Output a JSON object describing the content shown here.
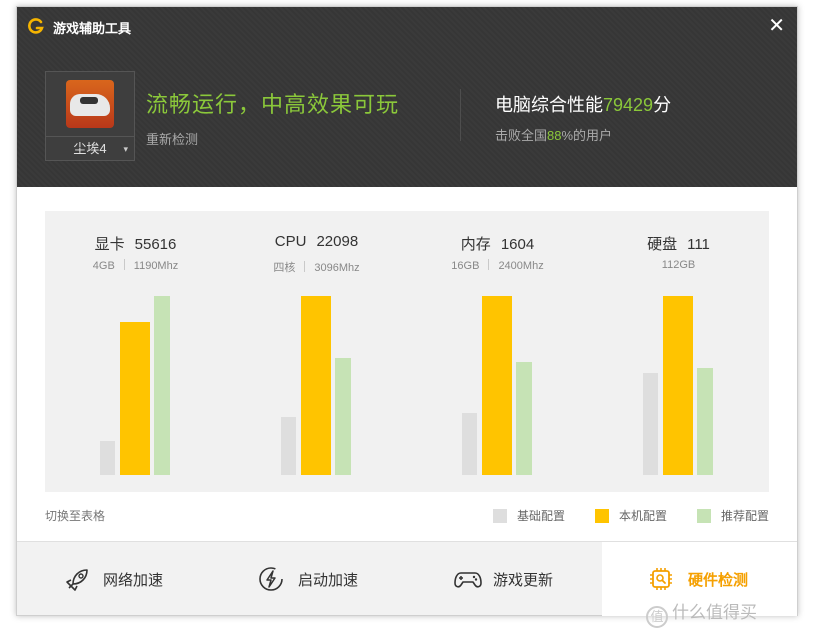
{
  "window": {
    "title": "游戏辅助工具",
    "close_glyph": "✕"
  },
  "game": {
    "selected": "尘埃4",
    "caret": "▾"
  },
  "result": {
    "headline": "流畅运行，中高效果可玩",
    "retest_label": "重新检测",
    "score_prefix": "电脑综合性能",
    "score_value": "79429",
    "score_suffix": "分",
    "beat_prefix": "击败全国",
    "beat_value": "88",
    "beat_suffix": "%的用户"
  },
  "hardware": [
    {
      "name": "显卡",
      "score": "55616",
      "specs": [
        "4GB",
        "1190Mhz"
      ],
      "base": 0.16,
      "mine": 0.72,
      "rec": 0.84
    },
    {
      "name": "CPU",
      "score": "22098",
      "specs": [
        "四核",
        "3096Mhz"
      ],
      "base": 0.27,
      "mine": 0.84,
      "rec": 0.55
    },
    {
      "name": "内存",
      "score": "1604",
      "specs": [
        "16GB",
        "2400Mhz"
      ],
      "base": 0.29,
      "mine": 0.84,
      "rec": 0.53
    },
    {
      "name": "硬盘",
      "score": "111",
      "specs": [
        "112GB"
      ],
      "base": 0.48,
      "mine": 0.84,
      "rec": 0.5
    }
  ],
  "legend": {
    "base": "基础配置",
    "mine": "本机配置",
    "rec": "推荐配置"
  },
  "switch_table": "切换至表格",
  "tabs": [
    {
      "label": "网络加速",
      "icon": "rocket-icon"
    },
    {
      "label": "启动加速",
      "icon": "lightning-icon"
    },
    {
      "label": "游戏更新",
      "icon": "gamepad-icon"
    },
    {
      "label": "硬件检测",
      "icon": "chip-search-icon",
      "active": true
    }
  ],
  "watermark": {
    "icon": "值",
    "text": "什么值得买"
  },
  "colors": {
    "accent": "#8bc83a",
    "active_tab": "#f5a000",
    "base": "#dedede",
    "mine": "#ffc400",
    "rec": "#c6e3b5"
  }
}
